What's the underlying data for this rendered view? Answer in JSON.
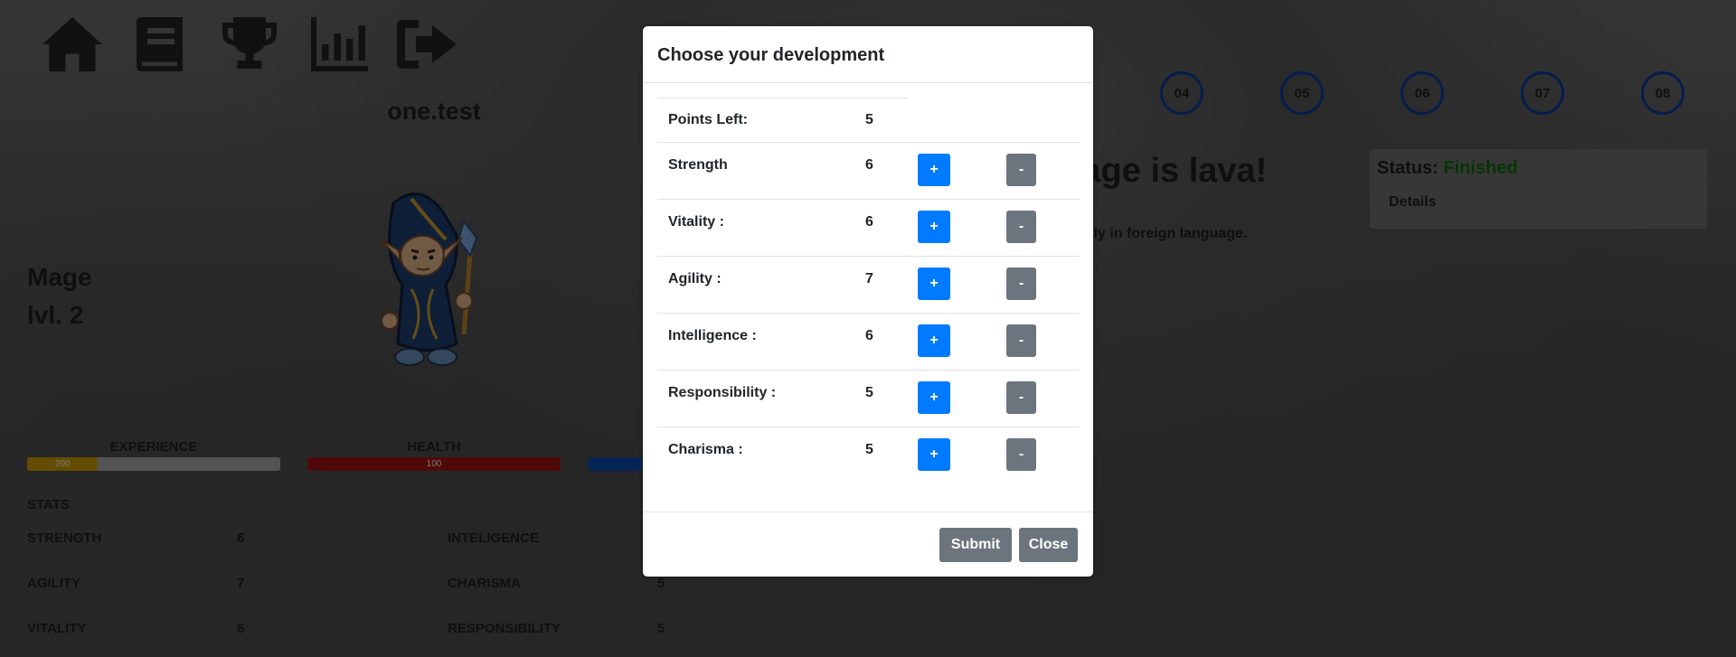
{
  "nav": {
    "icons": [
      "home-icon",
      "book-icon",
      "trophy-icon",
      "chart-icon",
      "logout-icon"
    ]
  },
  "profile": {
    "username": "one.test",
    "class_name": "Mage",
    "level": "lvl. 2"
  },
  "bars": {
    "experience": {
      "label": "EXPERIENCE",
      "value": "200",
      "fill_fraction": 0.28,
      "color": "#c99a00"
    },
    "health": {
      "label": "HEALTH",
      "value": "100",
      "fill_fraction": 1.0,
      "color": "#a01212"
    },
    "mana": {
      "color": "#0b4aa8"
    }
  },
  "stats": {
    "heading": "STATS",
    "left": [
      {
        "name": "STRENGTH",
        "value": "6"
      },
      {
        "name": "AGILITY",
        "value": "7"
      },
      {
        "name": "VITALITY",
        "value": "6"
      }
    ],
    "right": [
      {
        "name": "INTELIGENCE",
        "value": ""
      },
      {
        "name": "CHARISMA",
        "value": "5"
      },
      {
        "name": "RESPONSIBILITY",
        "value": "5"
      }
    ]
  },
  "levels": [
    "04",
    "05",
    "06",
    "07",
    "08"
  ],
  "quest": {
    "title_visible": "guage is lava!",
    "description_visible": "only in foreign language."
  },
  "status": {
    "label": "Status:",
    "value": "Finished",
    "value_color": "#0b6b0b",
    "details_label": "Details"
  },
  "modal": {
    "title": "Choose your development",
    "points_label": "Points Left:",
    "points_value": "5",
    "rows": [
      {
        "label": "Strength",
        "value": "6"
      },
      {
        "label": "Vitality :",
        "value": "6"
      },
      {
        "label": "Agility :",
        "value": "7"
      },
      {
        "label": "Intelligence :",
        "value": "6"
      },
      {
        "label": "Responsibility :",
        "value": "5"
      },
      {
        "label": "Charisma :",
        "value": "5"
      }
    ],
    "plus_label": "+",
    "minus_label": "-",
    "submit_label": "Submit",
    "close_label": "Close",
    "colors": {
      "primary": "#007bff",
      "secondary": "#6c757d"
    }
  }
}
